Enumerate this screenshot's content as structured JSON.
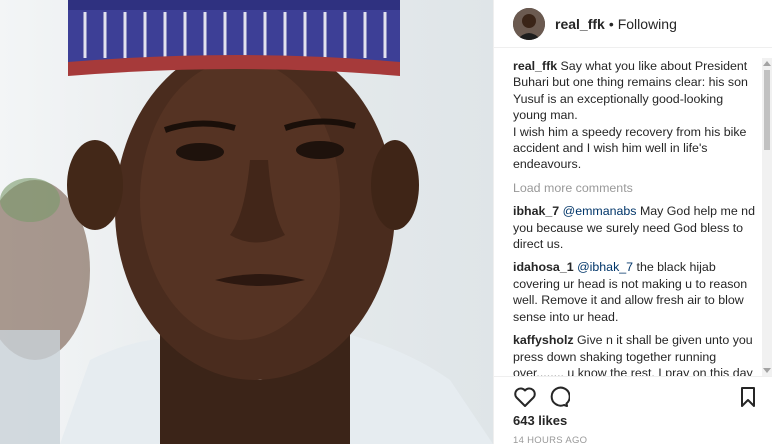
{
  "post": {
    "username": "real_ffk",
    "separator": "•",
    "follow_status": "Following"
  },
  "caption": {
    "username": "real_ffk",
    "text": "Say what you like about President Buhari but one thing remains clear: his son Yusuf is an exceptionally good-looking young man.",
    "text2": "I wish him a speedy recovery from his bike accident and I wish him well in life's endeavours."
  },
  "load_more": "Load more comments",
  "comments": [
    {
      "username": "ibhak_7",
      "mention": "@emmanabs",
      "text": "May God help me nd you because we surely need God bless to direct us."
    },
    {
      "username": "idahosa_1",
      "mention": "@ibhak_7",
      "text": "the black hijab covering ur head is not making u to reason well. Remove it and allow fresh air to blow sense into ur head."
    },
    {
      "username": "kaffysholz",
      "mention": "",
      "text": "Give n it shall be given unto you press down shaking together running over........ u know the rest. I pray on this day as God liveth. all that u have wished this"
    }
  ],
  "likes": "643 likes",
  "timestamp": "14 HOURS AGO",
  "icons": {
    "like": "heart-icon",
    "comment": "comment-icon",
    "save": "bookmark-icon"
  }
}
